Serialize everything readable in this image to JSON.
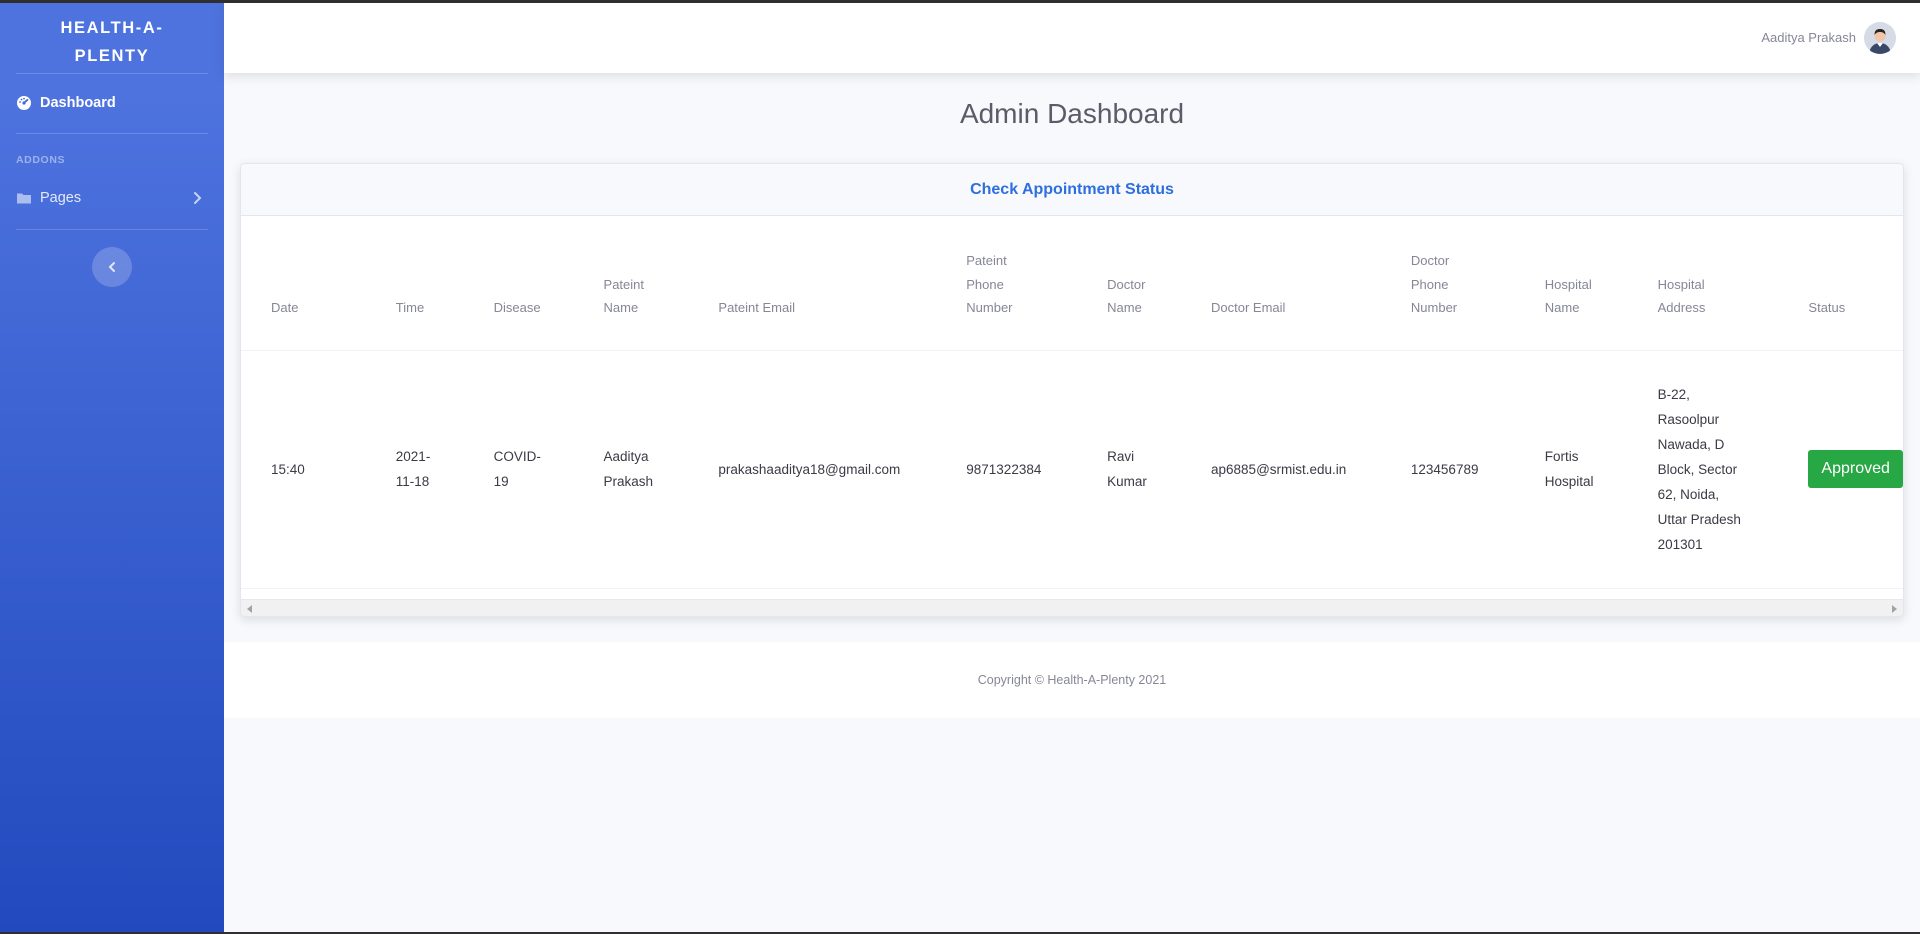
{
  "sidebar": {
    "brand_line1": "HEALTH-A-",
    "brand_line2": "PLENTY",
    "dashboard_label": "Dashboard",
    "section_heading": "ADDONS",
    "pages_label": "Pages"
  },
  "topbar": {
    "user_name": "Aaditya Prakash"
  },
  "main": {
    "page_title": "Admin Dashboard",
    "card_title": "Check Appointment Status",
    "table": {
      "headers": [
        [
          "Date"
        ],
        [
          "Time"
        ],
        [
          "Disease"
        ],
        [
          "Pateint",
          "Name"
        ],
        [
          "Pateint Email"
        ],
        [
          "Pateint",
          "Phone",
          "Number"
        ],
        [
          "Doctor",
          "Name"
        ],
        [
          "Doctor Email"
        ],
        [
          "Doctor",
          "Phone",
          "Number"
        ],
        [
          "Hospital",
          "Name"
        ],
        [
          "Hospital",
          "Address"
        ],
        [
          "Status"
        ]
      ],
      "rows": [
        {
          "date": "15:40",
          "time": [
            "2021-",
            "11-18"
          ],
          "disease": [
            "COVID-",
            "19"
          ],
          "patient_name": [
            "Aaditya",
            "Prakash"
          ],
          "patient_email": "prakashaaditya18@gmail.com",
          "patient_phone": "9871322384",
          "doctor_name": [
            "Ravi",
            "Kumar"
          ],
          "doctor_email": "ap6885@srmist.edu.in",
          "doctor_phone": "123456789",
          "hospital_name": [
            "Fortis",
            "Hospital"
          ],
          "hospital_address": [
            "B-22,",
            "Rasoolpur",
            "Nawada, D",
            "Block, Sector",
            "62, Noida,",
            "Uttar Pradesh",
            "201301"
          ],
          "status": "Approved"
        }
      ]
    }
  },
  "footer": {
    "copyright": "Copyright © Health-A-Plenty 2021"
  },
  "colors": {
    "sidebar_top": "#4e73df",
    "sidebar_bottom": "#224abe",
    "card_title": "#2e6fdf",
    "status_approved": "#28a745"
  },
  "icons": {
    "dashboard": "tachometer-icon",
    "pages": "folder-icon",
    "pages_chevron": "chevron-right-icon",
    "sidebar_toggle": "chevron-left-icon"
  }
}
